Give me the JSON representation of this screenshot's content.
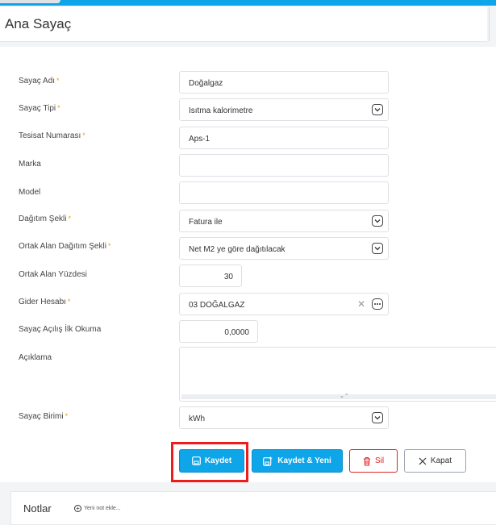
{
  "header": {
    "title": "Ana Sayaç"
  },
  "form": {
    "sayac_adi": {
      "label": "Sayaç Adı",
      "required": "*",
      "value": "Doğalgaz"
    },
    "sayac_tipi": {
      "label": "Sayaç Tipi",
      "required": "*",
      "value": "Isıtma kalorimetre"
    },
    "tesisat_no": {
      "label": "Tesisat Numarası",
      "required": "*",
      "value": "Aps-1"
    },
    "marka": {
      "label": "Marka",
      "value": ""
    },
    "model": {
      "label": "Model",
      "value": ""
    },
    "dagitim_sekli": {
      "label": "Dağıtım Şekli",
      "required": "*",
      "value": "Fatura ile"
    },
    "ortak_alan_dagitim": {
      "label": "Ortak Alan Dağıtım Şekli",
      "required": "*",
      "value": "Net M2 ye göre dağıtılacak"
    },
    "ortak_alan_yuzdesi": {
      "label": "Ortak Alan Yüzdesi",
      "value": "30"
    },
    "gider_hesabi": {
      "label": "Gider Hesabı",
      "required": "*",
      "value": "03 DOĞALGAZ"
    },
    "ilk_okuma": {
      "label": "Sayaç Açılış İlk Okuma",
      "value": "0,0000"
    },
    "aciklama": {
      "label": "Açıklama",
      "value": ""
    },
    "sayac_birimi": {
      "label": "Sayaç Birimi",
      "required": "*",
      "value": "kWh"
    }
  },
  "buttons": {
    "save": "Kaydet",
    "save_new": "Kaydet & Yeni",
    "delete": "Sil",
    "close": "Kapat"
  },
  "notes": {
    "title": "Notlar",
    "add_label": "Yeni not ekle..."
  },
  "colors": {
    "accent": "#0ea5e9",
    "danger": "#dc2626",
    "highlight": "#ef1c1c",
    "required": "#f59e0b"
  }
}
